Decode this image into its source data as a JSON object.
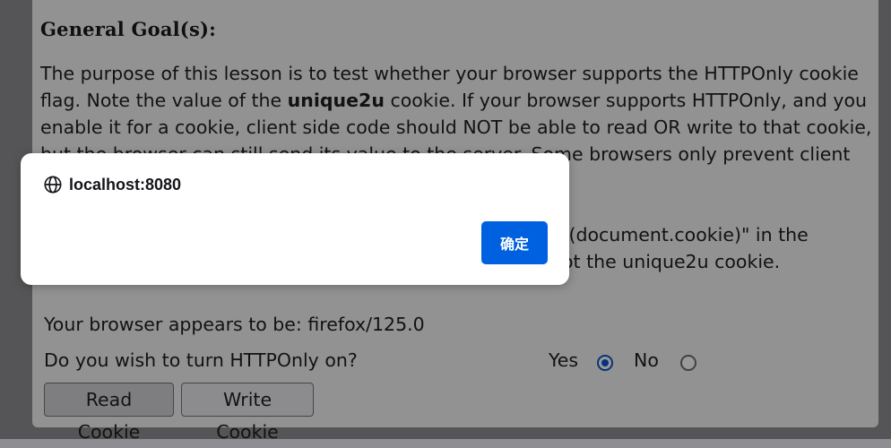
{
  "lesson": {
    "heading": "General Goal(s):",
    "para1_a": "The purpose of this lesson is to test whether your browser supports the HTTPOnly cookie flag. Note the value of the ",
    "para1_bold": "unique2u",
    "para1_b": " cookie. If your browser supports HTTPOnly, and you enable it for a cookie, client side code should NOT be able to read OR write to that cookie, but the browser can still send its value to the server. Some browsers only prevent client side",
    "para2_line1": "rt(document.cookie)\" in the",
    "para2_line2": "ot the unique2u cookie."
  },
  "form": {
    "browser_line": "Your browser appears to be: firefox/125.0",
    "question": "Do you wish to turn HTTPOnly on?",
    "yes_label": "Yes",
    "no_label": "No",
    "selected": "Yes",
    "read_cookie_label": "Read Cookie",
    "write_cookie_label": "Write Cookie"
  },
  "dialog": {
    "origin": "localhost:8080",
    "icon": "globe-icon",
    "ok_label": "确定"
  },
  "colors": {
    "accent": "#0061e0",
    "radio_selected": "#0a58ca"
  }
}
